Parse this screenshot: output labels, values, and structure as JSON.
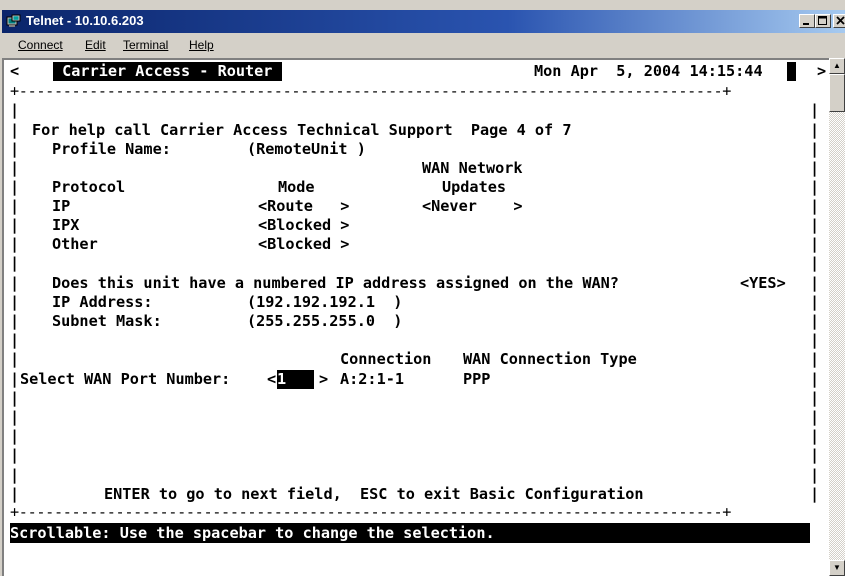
{
  "window": {
    "title": "Telnet - 10.10.6.203",
    "buttons": {
      "minimize": "_",
      "maximize": "□",
      "close": "x"
    }
  },
  "menu": {
    "items": [
      {
        "label": "Connect"
      },
      {
        "label": "Edit"
      },
      {
        "label": "Terminal"
      },
      {
        "label": "Help"
      }
    ]
  },
  "terminal": {
    "header_left_arrow": "<",
    "header_title": " Carrier Access - Router ",
    "header_datetime": "Mon Apr  5, 2004 14:15:44",
    "header_right_arrow": ">",
    "border_top": "+--------------------------------------------------------------------------------+",
    "border_bottom": "+--------------------------------------------------------------------------------+",
    "help_line": "For help call Carrier Access Technical Support  Page 4 of 7",
    "profile_label": "Profile Name:",
    "profile_value": "(RemoteUnit )",
    "col_wan_network": "WAN Network",
    "col_protocol": "Protocol",
    "col_mode": "Mode",
    "col_updates": "Updates",
    "rows": [
      {
        "protocol": "IP",
        "mode": "<Route   >",
        "updates": "<Never    >"
      },
      {
        "protocol": "IPX",
        "mode": "<Blocked >",
        "updates": ""
      },
      {
        "protocol": "Other",
        "mode": "<Blocked >",
        "updates": ""
      }
    ],
    "numbered_ip_question": "Does this unit have a numbered IP address assigned on the WAN?",
    "numbered_ip_value": "<YES>",
    "ip_address_label": "IP Address:",
    "ip_address_value": "(192.192.192.1  )",
    "subnet_mask_label": "Subnet Mask:",
    "subnet_mask_value": "(255.255.255.0  )",
    "col_connection": "Connection",
    "col_wan_connection_type": "WAN Connection Type",
    "wan_port_label": "Select WAN Port Number:",
    "wan_port_open": "<",
    "wan_port_value": "1",
    "wan_port_pad": "   ",
    "wan_port_close": ">",
    "connection_value": "A:2:1-1",
    "connection_type_value": "PPP",
    "footer_hint": "ENTER to go to next field,  ESC to exit Basic Configuration",
    "status_line": "Scrollable: Use the spacebar to change the selection."
  },
  "scrollbar": {
    "up_arrow": "▲",
    "down_arrow": "▼"
  }
}
